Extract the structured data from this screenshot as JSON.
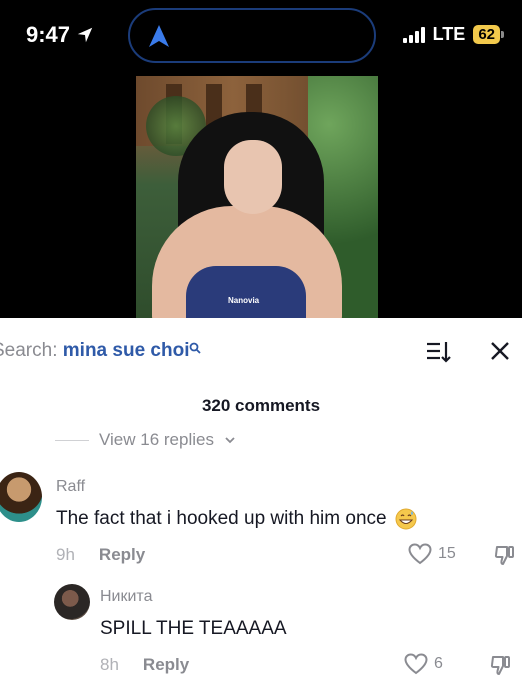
{
  "status_bar": {
    "time": "9:47",
    "network": "LTE",
    "battery": "62"
  },
  "video": {
    "watermark": "Nanovia"
  },
  "search": {
    "label": "Search: ",
    "query": "mina sue choi"
  },
  "comments_count": "320 comments",
  "view_replies": "View 16 replies",
  "comments": [
    {
      "username": "Raff",
      "text": "The fact that i hooked up with him once",
      "time": "9h",
      "reply_label": "Reply",
      "likes": "15"
    },
    {
      "username": "Никита",
      "text": "SPILL THE TEAAAAA",
      "time": "8h",
      "reply_label": "Reply",
      "likes": "6"
    }
  ],
  "colors": {
    "search_query": "#2f5aa8",
    "battery": "#f2c94c",
    "island_border": "#1b3c7a"
  },
  "icons": [
    "location-arrow-icon",
    "navigation-icon",
    "signal-icon",
    "battery-icon",
    "search-icon",
    "sort-icon",
    "close-icon",
    "heart-icon",
    "dislike-icon",
    "grin-sweat-emoji-icon"
  ]
}
